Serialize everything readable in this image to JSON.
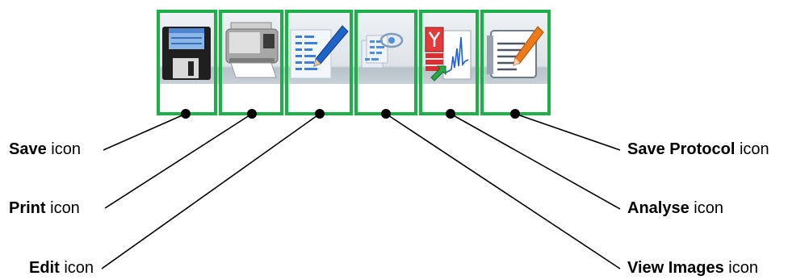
{
  "colors": {
    "frame": "#1db049",
    "toolbar_top": "#e9eef2",
    "toolbar_bottom": "#c3ccd3",
    "line": "#000000"
  },
  "labels": {
    "save": {
      "name": "Save",
      "suffix": " icon"
    },
    "print": {
      "name": "Print",
      "suffix": " icon"
    },
    "edit": {
      "name": "Edit",
      "suffix": " icon"
    },
    "save_protocol": {
      "name": "Save Protocol",
      "suffix": " icon"
    },
    "analyse": {
      "name": "Analyse",
      "suffix": " icon"
    },
    "view_images": {
      "name": "View Images",
      "suffix": " icon"
    }
  },
  "icons": [
    "floppy-disk-icon",
    "printer-icon",
    "edit-pencil-icon",
    "view-images-icon",
    "analyse-chart-icon",
    "save-protocol-notepad-icon"
  ]
}
